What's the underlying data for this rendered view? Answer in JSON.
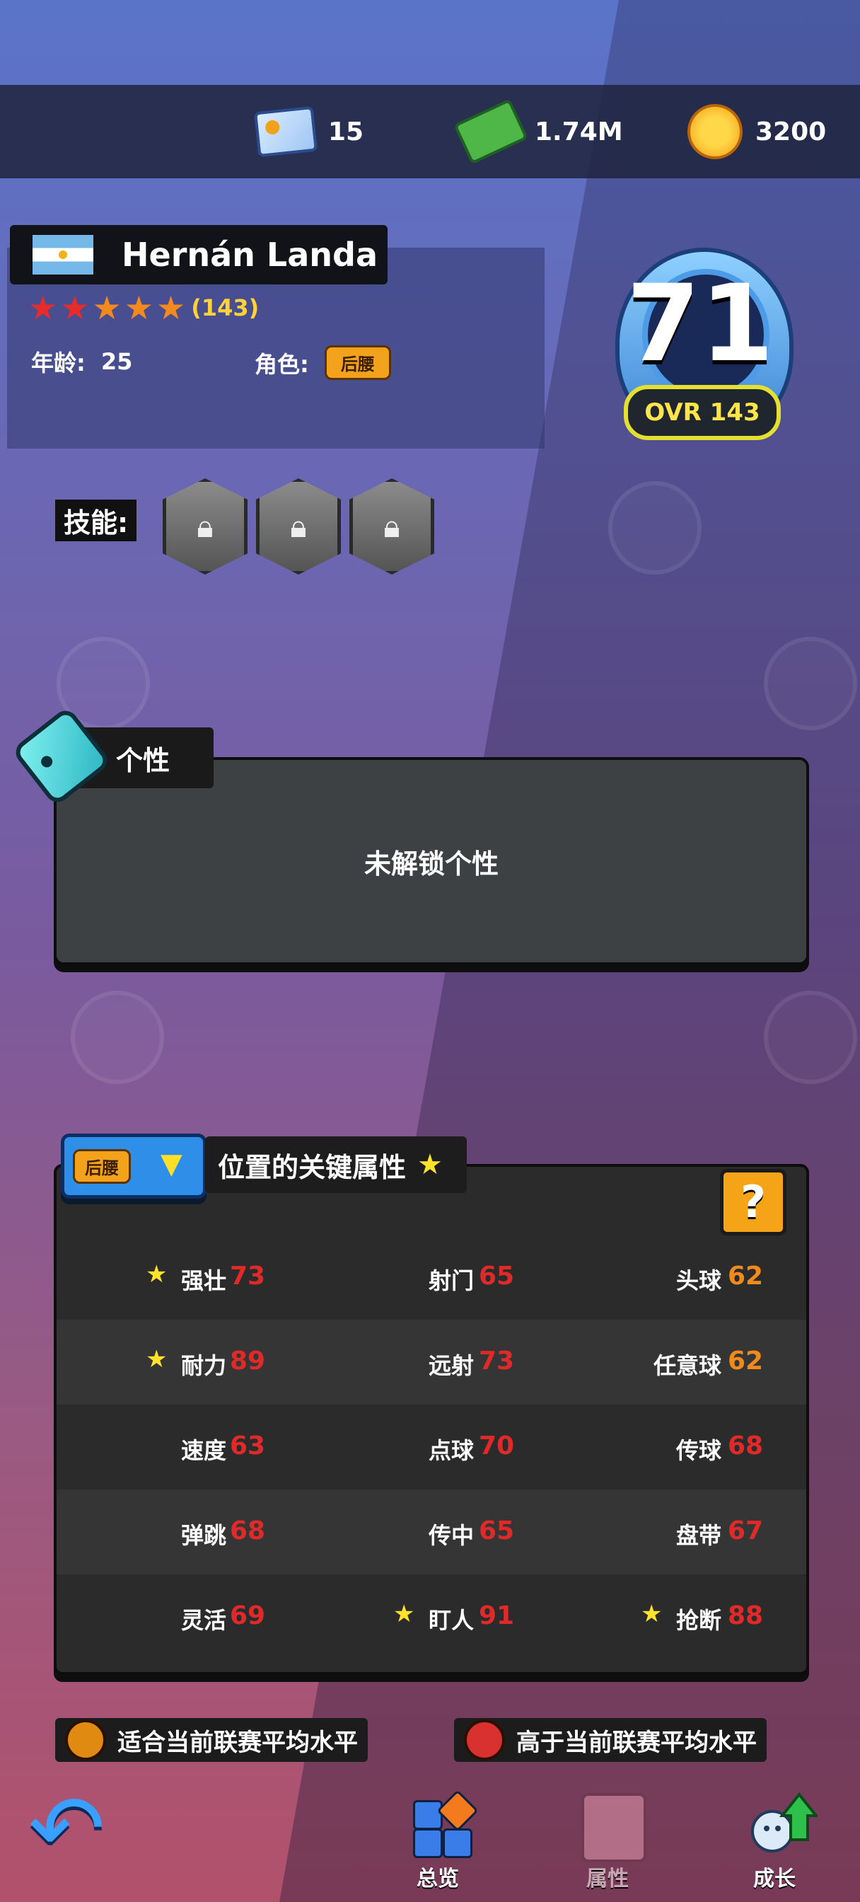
{
  "topbar": {
    "cards": "15",
    "cash": "1.74M",
    "coins": "3200"
  },
  "player": {
    "name": "Hernán Landa",
    "stars_count": "(143)",
    "age_label": "年龄:",
    "age": "25",
    "role_label": "角色:",
    "role": "后腰",
    "ovr": "71",
    "ovr_label": "OVR 143",
    "flag_country": "Argentina"
  },
  "skills": {
    "label": "技能:",
    "slots": [
      "locked",
      "locked",
      "locked"
    ]
  },
  "personality": {
    "title": "个性",
    "empty_text": "未解锁个性"
  },
  "key_attributes": {
    "position": "后腰",
    "title": "位置的关键属性",
    "help": "?",
    "rows": [
      [
        {
          "label": "强壮",
          "value": "73",
          "star": true,
          "color": "red"
        },
        {
          "label": "射门",
          "value": "65",
          "star": false,
          "color": "red"
        },
        {
          "label": "头球",
          "value": "62",
          "star": false,
          "color": "orange"
        }
      ],
      [
        {
          "label": "耐力",
          "value": "89",
          "star": true,
          "color": "red"
        },
        {
          "label": "远射",
          "value": "73",
          "star": false,
          "color": "red"
        },
        {
          "label": "任意球",
          "value": "62",
          "star": false,
          "color": "orange"
        }
      ],
      [
        {
          "label": "速度",
          "value": "63",
          "star": false,
          "color": "red"
        },
        {
          "label": "点球",
          "value": "70",
          "star": false,
          "color": "red"
        },
        {
          "label": "传球",
          "value": "68",
          "star": false,
          "color": "red"
        }
      ],
      [
        {
          "label": "弹跳",
          "value": "68",
          "star": false,
          "color": "red"
        },
        {
          "label": "传中",
          "value": "65",
          "star": false,
          "color": "red"
        },
        {
          "label": "盘带",
          "value": "67",
          "star": false,
          "color": "red"
        }
      ],
      [
        {
          "label": "灵活",
          "value": "69",
          "star": false,
          "color": "red"
        },
        {
          "label": "盯人",
          "value": "91",
          "star": true,
          "color": "red"
        },
        {
          "label": "抢断",
          "value": "88",
          "star": true,
          "color": "red"
        }
      ]
    ]
  },
  "legend": {
    "average": "适合当前联赛平均水平",
    "above": "高于当前联赛平均水平",
    "average_color": "#e08a12",
    "above_color": "#d93030"
  },
  "nav": {
    "overview": "总览",
    "attributes": "属性",
    "growth": "成长"
  },
  "colors": {
    "value_red": "#e02a2a",
    "value_orange": "#f08a1a",
    "accent_yellow": "#ffe22c"
  }
}
